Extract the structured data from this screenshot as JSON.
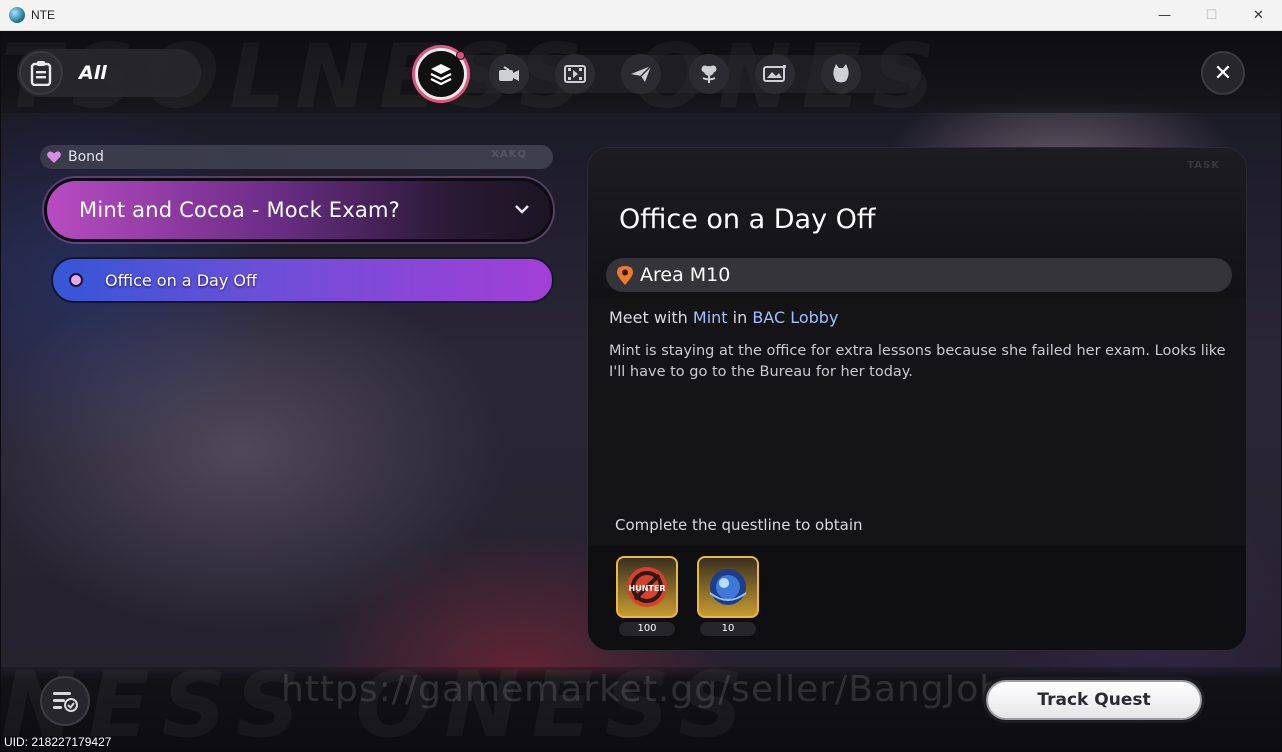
{
  "window": {
    "title": "NTE",
    "minimize_glyph": "—",
    "maximize_glyph": "☐",
    "close_glyph": "✕"
  },
  "filter": {
    "label": "All",
    "icon": "clipboard-icon"
  },
  "tabs": [
    {
      "icon": "layers-icon",
      "active": true,
      "has_notification": true
    },
    {
      "icon": "camera-icon",
      "active": false
    },
    {
      "icon": "film-icon",
      "active": false
    },
    {
      "icon": "paper-plane-icon",
      "active": false
    },
    {
      "icon": "flower-icon",
      "active": false
    },
    {
      "icon": "photo-card-icon",
      "active": false
    },
    {
      "icon": "cat-icon",
      "active": false
    }
  ],
  "close_glyph": "✕",
  "background_watermark_top": "TSOLNESS ONES",
  "background_watermark_bottom": "NESS ONESS",
  "quest_list": {
    "category": {
      "label": "Bond",
      "icon": "heart-icon",
      "tag": "XAKQ"
    },
    "questline": {
      "title": "Mint and Cocoa - Mock Exam?",
      "expanded": true
    },
    "items": [
      {
        "label": "Office on a Day Off",
        "selected": true
      }
    ]
  },
  "detail": {
    "tag": "TASK",
    "title": "Office on a Day Off",
    "area": "Area M10",
    "objective": {
      "prefix": "Meet with ",
      "npc": "Mint",
      "mid": " in ",
      "location": "BAC Lobby"
    },
    "description": "Mint is staying at the office for extra lessons because she failed her exam. Looks like I'll have to go to the Bureau for her today.",
    "reward_heading": "Complete the questline to obtain",
    "rewards": [
      {
        "name": "hunter-badge-item",
        "quantity": "100",
        "logo_text": "HUNTER"
      },
      {
        "name": "blue-orb-item",
        "quantity": "10"
      }
    ]
  },
  "watermark": "https://gamemarket.gg/seller/BangJohn",
  "track_button": "Track Quest",
  "uid": "UID: 218227179427",
  "colors": {
    "accent_pink": "#e0557f",
    "questline_purple": "#b84cc2",
    "quest_blue": "#3556d8",
    "highlight_blue": "#9fc0ff",
    "reward_gold": "#e8b848"
  }
}
